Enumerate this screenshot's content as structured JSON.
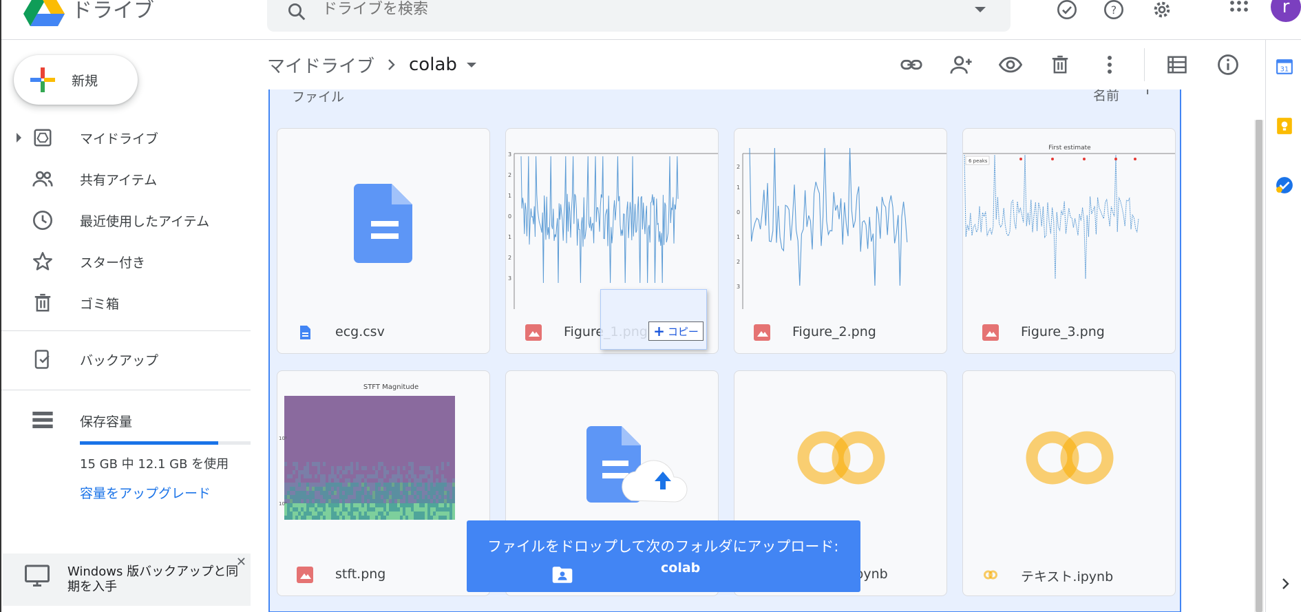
{
  "app": {
    "logo_text": "ドライブ"
  },
  "search": {
    "placeholder": "ドライブを検索"
  },
  "avatar_letter": "r",
  "sidebar": {
    "new_label": "新規",
    "items": [
      {
        "label": "マイドライブ",
        "icon": "my-drive-icon"
      },
      {
        "label": "共有アイテム",
        "icon": "shared-icon"
      },
      {
        "label": "最近使用したアイテム",
        "icon": "recent-clock-icon"
      },
      {
        "label": "スター付き",
        "icon": "star-icon"
      },
      {
        "label": "ゴミ箱",
        "icon": "trash-icon"
      }
    ],
    "backup_label": "バックアップ",
    "storage_label": "保存容量",
    "storage_used_fraction": 0.81,
    "storage_text": "15 GB 中 12.1 GB を使用",
    "upgrade_label": "容量をアップグレード",
    "promo_text": "Windows 版バックアップと同期を入手"
  },
  "breadcrumb": {
    "root": "マイドライブ",
    "current": "colab"
  },
  "content": {
    "section_label": "ファイル",
    "sort_label": "名前"
  },
  "files": [
    {
      "name": "ecg.csv",
      "type": "doc"
    },
    {
      "name": "Figure_1.png",
      "type": "image"
    },
    {
      "name": "Figure_2.png",
      "type": "image"
    },
    {
      "name": "Figure_3.png",
      "type": "image"
    },
    {
      "name": "stft.png",
      "type": "image"
    },
    {
      "name": "",
      "type": "upload"
    },
    {
      "name": "ipynb",
      "type": "colab"
    },
    {
      "name": "テキスト.ipynb",
      "type": "colab"
    }
  ],
  "thumbs": {
    "figure3_title": "First estimate",
    "figure3_legend": "6 peaks",
    "stft_title": "STFT Magnitude"
  },
  "drag": {
    "copy_label": "コピー",
    "copy_glyph": "+"
  },
  "drop_banner": {
    "text": "ファイルをドロップして次のフォルダにアップロード:",
    "folder": "colab"
  },
  "colors": {
    "accent": "#4285f4",
    "drop_bg": "#4285f4",
    "content_bg": "#e8f0fe",
    "link": "#1a73e8"
  }
}
